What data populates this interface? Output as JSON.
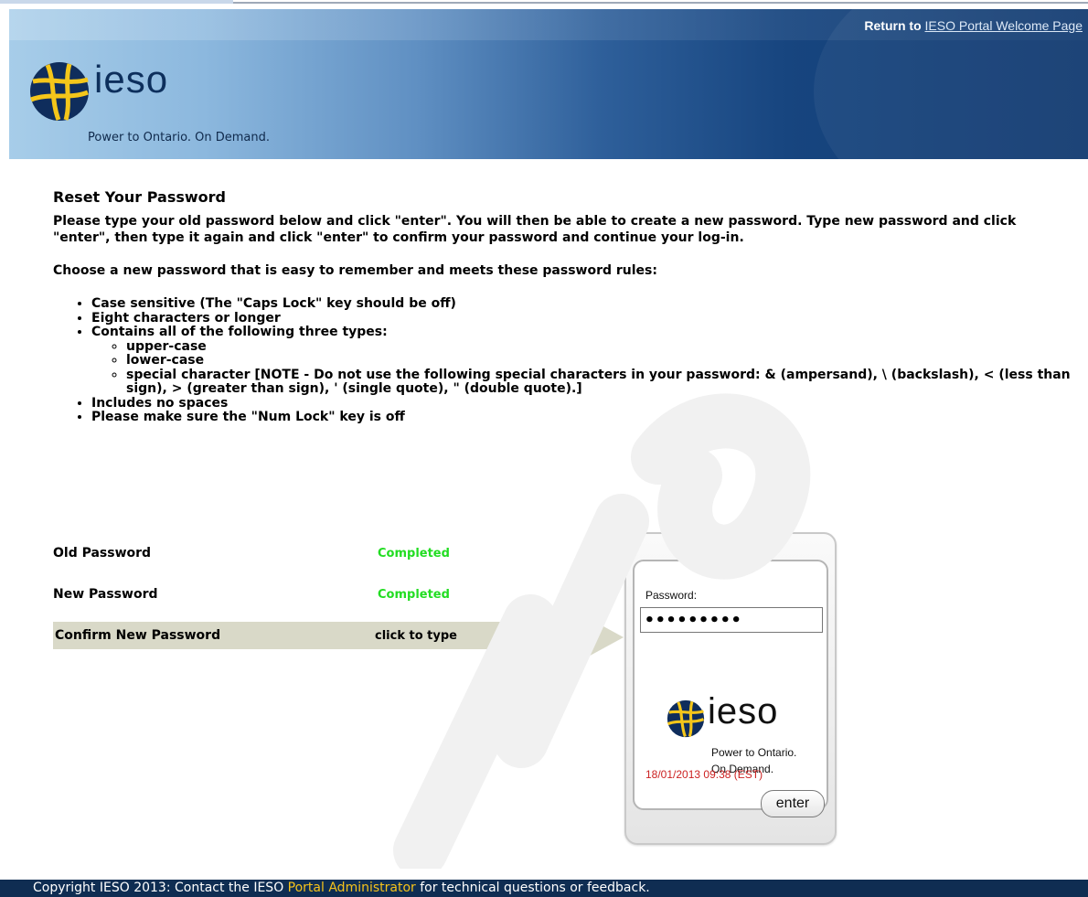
{
  "header": {
    "return_prefix": "Return to",
    "return_link": "IESO Portal Welcome Page",
    "logo_word": "ieso",
    "tagline": "Power to Ontario. On Demand."
  },
  "main": {
    "title": "Reset Your Password",
    "intro": "Please type your old password below and click \"enter\". You will then be able to create a new password. Type new password and click \"enter\", then type it again and click \"enter\" to confirm your password and continue your log-in.",
    "choose": "Choose a new password that is easy to remember and meets these password rules:",
    "rules": [
      "Case sensitive (The \"Caps Lock\" key should be off)",
      "Eight characters or longer",
      "Contains all of the following three types:",
      "Includes no spaces",
      "Please make sure the \"Num Lock\" key is off"
    ],
    "subrules": [
      "upper-case",
      "lower-case",
      "special character [NOTE - Do not use the following special characters in your password: & (ampersand), \\ (backslash), < (less than sign), > (greater than sign), ' (single quote), \" (double quote).]"
    ]
  },
  "steps": [
    {
      "label": "Old Password",
      "status": "Completed"
    },
    {
      "label": "New Password",
      "status": "Completed"
    },
    {
      "label": "Confirm New Password",
      "status": "click to type"
    }
  ],
  "device": {
    "password_label": "Password:",
    "password_value": "•••••••••",
    "logo_word": "ieso",
    "tagline_line1": "Power to Ontario.",
    "tagline_line2": "On Demand.",
    "datetime": "18/01/2013 09:38 (EST)",
    "enter_label": "enter"
  },
  "footer": {
    "prefix": "Copyright IESO 2013: Contact the IESO",
    "link": "Portal Administrator",
    "suffix": "for technical questions or feedback."
  },
  "colors": {
    "completed": "#22dd22",
    "datetime": "#cc2222",
    "footer_bg": "#0f2d52",
    "footer_link": "#f5c21b",
    "step_highlight": "#d9d9c8"
  }
}
